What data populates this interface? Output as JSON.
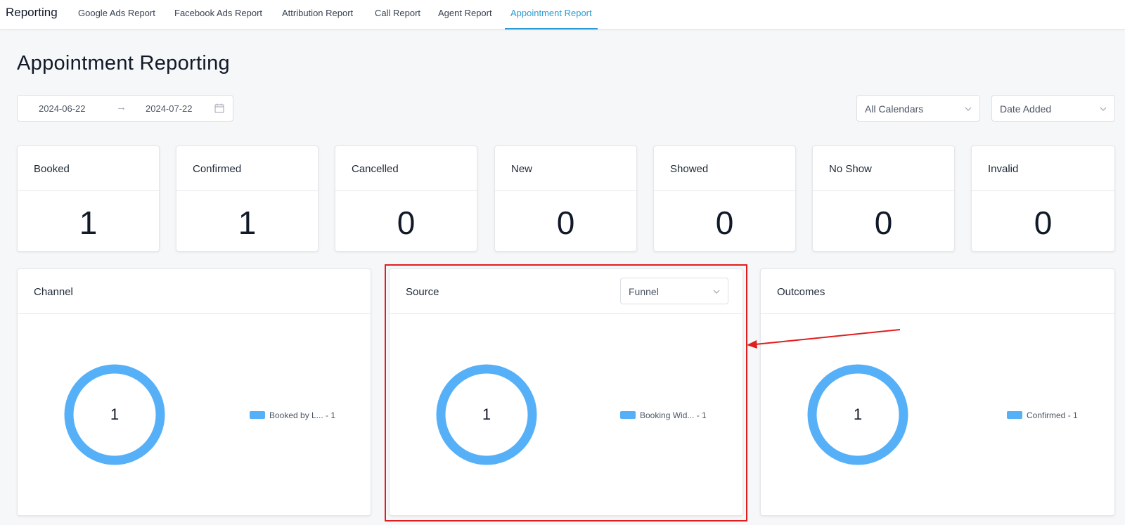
{
  "nav": {
    "brand": "Reporting",
    "tabs": [
      {
        "label": "Google Ads Report"
      },
      {
        "label": "Facebook Ads Report"
      },
      {
        "label": "Attribution Report"
      },
      {
        "label": "Call Report"
      },
      {
        "label": "Agent Report"
      },
      {
        "label": "Appointment Report",
        "active": true
      }
    ]
  },
  "page": {
    "title": "Appointment Reporting"
  },
  "filters": {
    "date_start": "2024-06-22",
    "date_end": "2024-07-22",
    "calendar_select": "All Calendars",
    "date_type_select": "Date Added"
  },
  "stats": [
    {
      "label": "Booked",
      "value": "1"
    },
    {
      "label": "Confirmed",
      "value": "1"
    },
    {
      "label": "Cancelled",
      "value": "0"
    },
    {
      "label": "New",
      "value": "0"
    },
    {
      "label": "Showed",
      "value": "0"
    },
    {
      "label": "No Show",
      "value": "0"
    },
    {
      "label": "Invalid",
      "value": "0"
    }
  ],
  "panels": [
    {
      "title": "Channel",
      "center": "1",
      "legend": "Booked by L... - 1"
    },
    {
      "title": "Source",
      "center": "1",
      "legend": "Booking Wid... - 1",
      "select": "Funnel"
    },
    {
      "title": "Outcomes",
      "center": "1",
      "legend": "Confirmed - 1"
    }
  ],
  "colors": {
    "accent": "#2a9dd4",
    "donut": "#56b0f8",
    "highlight": "#e11d1d"
  },
  "chart_data": [
    {
      "type": "pie",
      "title": "Channel",
      "categories": [
        "Booked by L..."
      ],
      "values": [
        1
      ]
    },
    {
      "type": "pie",
      "title": "Source",
      "categories": [
        "Booking Wid..."
      ],
      "values": [
        1
      ]
    },
    {
      "type": "pie",
      "title": "Outcomes",
      "categories": [
        "Confirmed"
      ],
      "values": [
        1
      ]
    }
  ]
}
